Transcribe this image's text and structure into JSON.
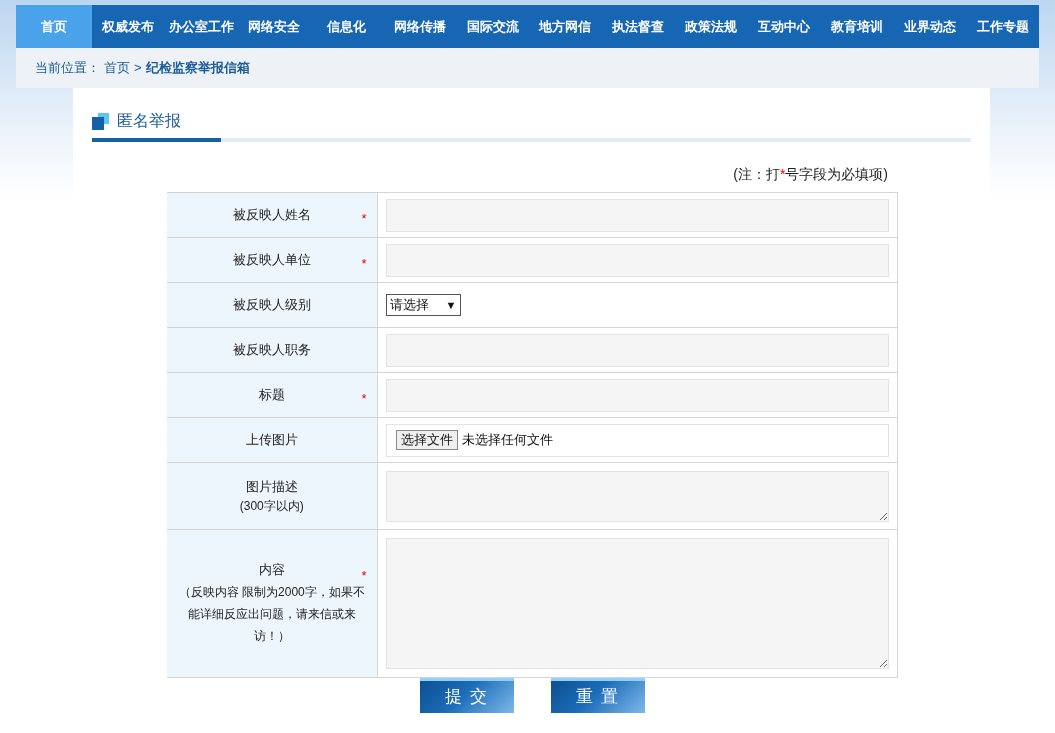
{
  "nav": [
    {
      "label": "首页",
      "selected": true
    },
    {
      "label": "权威发布",
      "selected": false
    },
    {
      "label": "办公室工作",
      "selected": false
    },
    {
      "label": "网络安全",
      "selected": false
    },
    {
      "label": "信息化",
      "selected": false
    },
    {
      "label": "网络传播",
      "selected": false
    },
    {
      "label": "国际交流",
      "selected": false
    },
    {
      "label": "地方网信",
      "selected": false
    },
    {
      "label": "执法督查",
      "selected": false
    },
    {
      "label": "政策法规",
      "selected": false
    },
    {
      "label": "互动中心",
      "selected": false
    },
    {
      "label": "教育培训",
      "selected": false
    },
    {
      "label": "业界动态",
      "selected": false
    },
    {
      "label": "工作专题",
      "selected": false
    }
  ],
  "breadcrumb": {
    "prefix": "当前位置：",
    "home": "首页",
    "separator": ">",
    "current": "纪检监察举报信箱"
  },
  "section_title": "匿名举报",
  "note": {
    "before": "(注：打",
    "mark": "*",
    "after": "号字段为必填项)"
  },
  "rows": [
    {
      "label": "被反映人姓名",
      "mark": "*",
      "kind": "text"
    },
    {
      "label": "被反映人单位",
      "mark": "*",
      "kind": "text"
    },
    {
      "label": "被反映人级别",
      "kind": "select",
      "value": "请选择",
      "caret": "▼"
    },
    {
      "label": "被反映人职务",
      "kind": "text"
    },
    {
      "label": "标题",
      "mark": "*",
      "kind": "text"
    },
    {
      "label": "上传图片",
      "kind": "file",
      "button": "选择文件",
      "status": "未选择任何文件"
    },
    {
      "label": "图片描述",
      "sublabel": "(300字以内)",
      "kind": "textarea_small"
    },
    {
      "label": "内容",
      "sublabel": "（反映内容 限制为2000字，如果不能详细反应出问题，请来信或来访！）",
      "mark": "*",
      "kind": "textarea_large"
    }
  ],
  "buttons": [
    "提 交",
    "重 置"
  ]
}
